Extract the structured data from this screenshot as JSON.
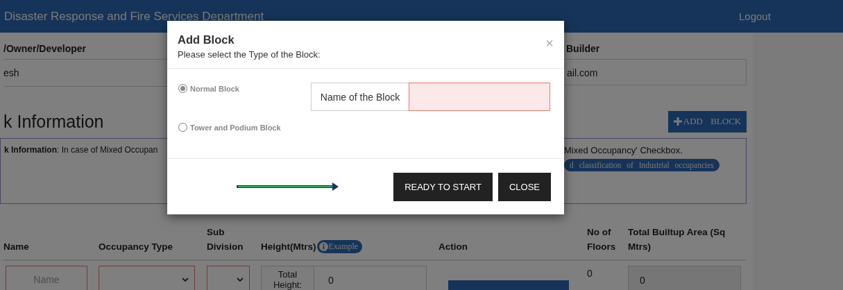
{
  "header": {
    "title": "Disaster Response and Fire Services Department",
    "logout": "Logout"
  },
  "owner": {
    "label": "/Owner/Developer",
    "value": "esh"
  },
  "builder": {
    "label": "Builder",
    "value": "ail.com"
  },
  "section_title": "k Information",
  "add_block_button": "ADD BLOCK",
  "info": {
    "text": "**k Information**: In case of Mixed Occupan",
    "text_right": "Mixed Occupancy' Checkbox.",
    "pill": "d classification of Industrial occupancies"
  },
  "table": {
    "columns": [
      "Name",
      "Occupancy Type",
      "Sub Division",
      "Height(Mtrs)",
      "Action",
      "No of Floors",
      "Total Builtup Area (Sq Mtrs)"
    ],
    "example_badge": "Example",
    "row": {
      "name_placeholder": "Name",
      "height_label": "Total Height:",
      "height_value": "0",
      "floors": "0",
      "area": "0"
    }
  },
  "modal": {
    "title": "Add Block",
    "subtitle": "Please select the Type of the Block:",
    "close": "×",
    "options": [
      {
        "label": "Normal Block",
        "selected": true
      },
      {
        "label": "Tower and Podium Block",
        "selected": false
      }
    ],
    "name_label": "Name of the Block",
    "buttons": [
      "READY TO START",
      "CLOSE"
    ]
  }
}
